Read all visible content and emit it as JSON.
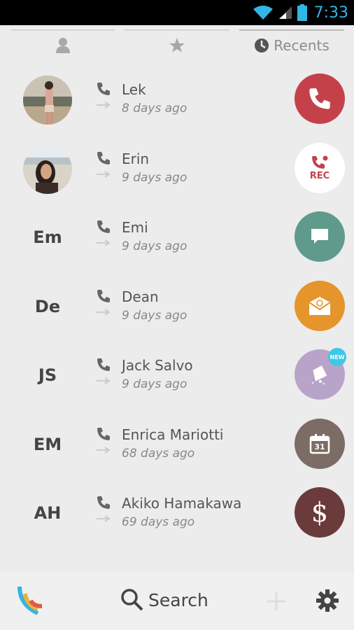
{
  "status_bar": {
    "time": "7:33"
  },
  "tabs": [
    {
      "name": "contacts",
      "label": ""
    },
    {
      "name": "favorites",
      "label": ""
    },
    {
      "name": "recents",
      "label": "Recents"
    }
  ],
  "recents": [
    {
      "name": "Lek",
      "time": "8 days ago",
      "initials": "",
      "has_photo": true,
      "action": "call",
      "action_color": "#c4414a"
    },
    {
      "name": "Erin",
      "time": "9 days ago",
      "initials": "",
      "has_photo": true,
      "action": "record",
      "action_color": "#ffffff",
      "action_label": "REC"
    },
    {
      "name": "Emi",
      "time": "9 days ago",
      "initials": "Em",
      "has_photo": false,
      "action": "message",
      "action_color": "#5f9a8c"
    },
    {
      "name": "Dean",
      "time": "9 days ago",
      "initials": "De",
      "has_photo": false,
      "action": "email",
      "action_color": "#e5952b"
    },
    {
      "name": "Jack Salvo",
      "time": "9 days ago",
      "initials": "JS",
      "has_photo": false,
      "action": "reminder",
      "action_color": "#b9a4c9",
      "badge": "NEW"
    },
    {
      "name": "Enrica Mariotti",
      "time": "68 days ago",
      "initials": "EM",
      "has_photo": false,
      "action": "calendar",
      "action_color": "#7b6d66",
      "calendar_day": "31"
    },
    {
      "name": "Akiko Hamakawa",
      "time": "69 days ago",
      "initials": "AH",
      "has_photo": false,
      "action": "payment",
      "action_color": "#6b3a3b"
    }
  ],
  "bottom_bar": {
    "search_label": "Search"
  },
  "colors": {
    "background": "#ececec",
    "accent_blue": "#33b5e5"
  }
}
